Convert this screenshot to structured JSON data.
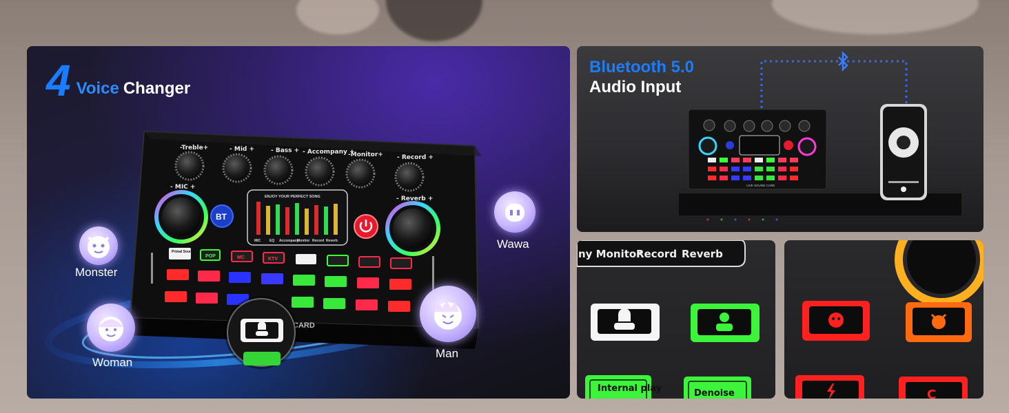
{
  "left_panel": {
    "number": "4",
    "title_blue": "Voice",
    "title_white": "Changer",
    "modes": [
      "Monster",
      "Wawa",
      "Woman",
      "Man"
    ],
    "knob_labels": [
      "-Treble+",
      "- Mid +",
      "- Bass +",
      "- Accompany +",
      "-Monitor+",
      "- Record +",
      "- MIC +",
      "- Reverb +"
    ],
    "screen_title": "ENJOY YOUR PERFECT SONG",
    "screen_labels": [
      "MIC",
      "EQ",
      "Accompany",
      "Monitor",
      "Record",
      "Reverb"
    ],
    "keys_row1": [
      "Primal Sound",
      "POP",
      "MC",
      "KTV"
    ],
    "bt_badge": "BT",
    "brand_text": "CARD"
  },
  "right_top_panel": {
    "title_blue": "Bluetooth 5.0",
    "title_white": "Audio Input",
    "device_text": "LIVE SOUND CARD"
  },
  "bottom_middle_panel": {
    "labels": [
      "ny Monitor",
      "Record",
      "Reverb"
    ],
    "keys": [
      "Internal play",
      "Denoise"
    ]
  },
  "bottom_right_panel": {
    "key_letter": "C"
  },
  "colors": {
    "accent_blue": "#1a7dff",
    "green_key": "#3cff3a",
    "red_key": "#ff2a2a",
    "orange_key": "#ff6a10"
  }
}
